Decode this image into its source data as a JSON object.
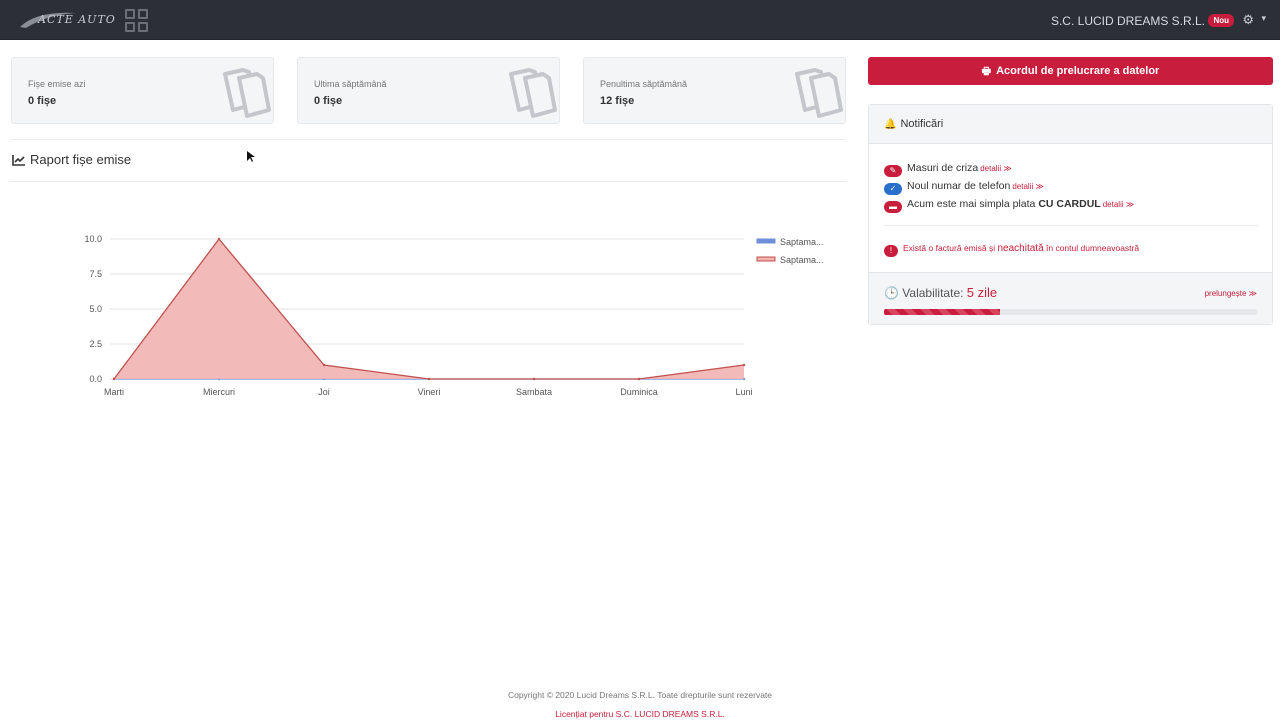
{
  "header": {
    "logo_text": "ACTE AUTO",
    "company": "S.C. LUCID DREAMS S.R.L.",
    "badge": "Nou",
    "icons": [
      "apps-grid-icon",
      "gear-icon",
      "caret-down-icon"
    ]
  },
  "stats": [
    {
      "label": "Fișe emise azi",
      "value": "0 fișe",
      "icon": "documents-icon"
    },
    {
      "label": "Ultima săptămână",
      "value": "0 fișe",
      "icon": "documents-icon"
    },
    {
      "label": "Penultima săptămână",
      "value": "12 fișe",
      "icon": "documents-icon"
    }
  ],
  "report": {
    "title": "Raport fișe emise",
    "icon": "line-chart-icon"
  },
  "chart_data": {
    "type": "area",
    "categories": [
      "Marti",
      "Miercuri",
      "Joi",
      "Vineri",
      "Sambata",
      "Duminica",
      "Luni"
    ],
    "series": [
      {
        "name": "Saptama...",
        "values": [
          0,
          0,
          0,
          0,
          0,
          0,
          0
        ],
        "color": "#6f8fd8"
      },
      {
        "name": "Saptama...",
        "values": [
          0,
          10,
          1,
          0,
          0,
          0,
          1
        ],
        "color": "#c0504d",
        "fill": "#f1b2b0"
      }
    ],
    "ylim": [
      0,
      10
    ],
    "yticks": [
      "0.0",
      "2.5",
      "5.0",
      "7.5",
      "10.0"
    ],
    "grid": true,
    "legend": "top-right"
  },
  "consent_button": {
    "label": "Acordul de prelucrare a datelor",
    "icon": "print-icon"
  },
  "notifications": {
    "title": "Notificări",
    "items": [
      {
        "text": "Masuri de criza",
        "more": "detalii ≫",
        "icon": "pencil-icon",
        "color": "#c81d3c"
      },
      {
        "text": "Noul numar de telefon",
        "more": "detalii ≫",
        "icon": "check-icon",
        "color": "#2b6fcc"
      },
      {
        "text": "Acum este mai simpla plata ",
        "strong": "CU CARDUL",
        "more": "detalii ≫",
        "icon": "card-icon",
        "color": "#c81d3c"
      }
    ],
    "invoice_pre": "Există o factură emisă și ",
    "invoice_strong": "neachitată",
    "invoice_post": " în contul dumneavoastră",
    "invoice_icon": "alert-icon"
  },
  "validity": {
    "label": "Valabilitate: ",
    "days": "5 zile",
    "extend": "prelungește ≫",
    "progress": 0.31,
    "icon": "clock-icon"
  },
  "footer": {
    "copyright": "Copyright © 2020 Lucid Dreams S.R.L. Toate drepturile sunt rezervate",
    "licensed": "Licențiat pentru S.C. LUCID DREAMS S.R.L."
  }
}
